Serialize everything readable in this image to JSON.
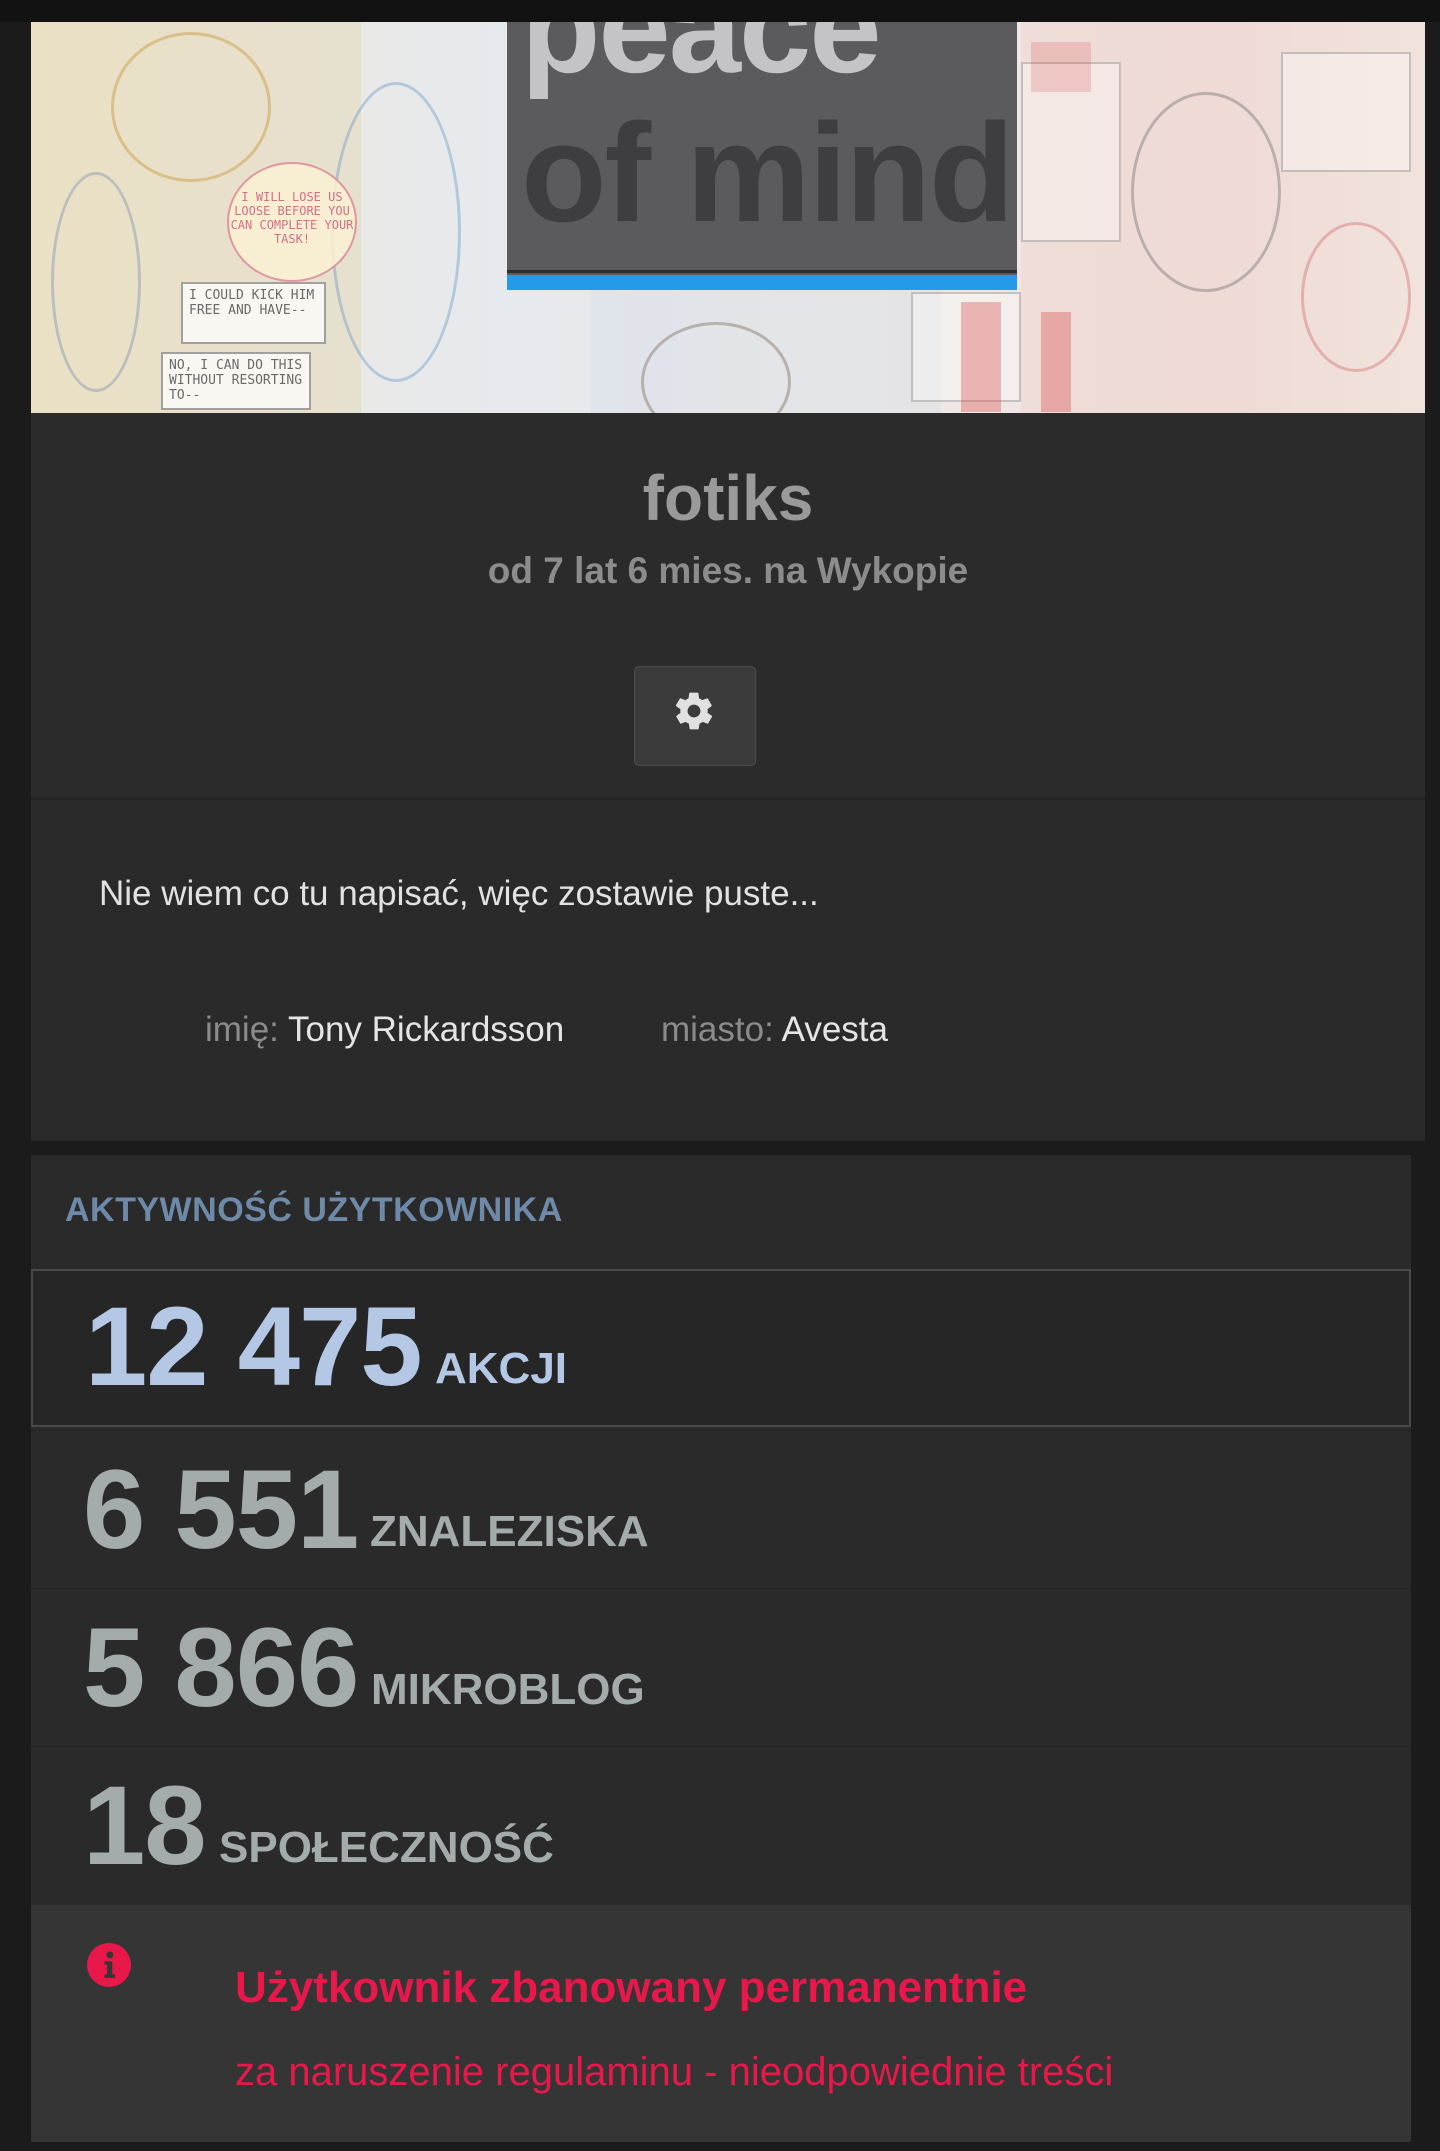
{
  "banner": {
    "line1": "peace",
    "line2": "of mind",
    "comic_text_1": "I COULD KICK HIM FREE AND HAVE--",
    "comic_text_2": "NO, I CAN DO THIS WITHOUT RESORTING TO--",
    "comic_bubble": "I WILL LOSE US LOOSE BEFORE YOU CAN COMPLETE YOUR TASK!"
  },
  "profile": {
    "username": "fotiks",
    "member_since": "od 7 lat 6 mies. na Wykopie",
    "settings_icon": "gear-icon"
  },
  "about": {
    "description": "Nie wiem co tu napisać, więc zostawie puste...",
    "name_label": "imię:",
    "name_value": "Tony Rickardsson",
    "city_label": "miasto:",
    "city_value": "Avesta"
  },
  "activity": {
    "title": "AKTYWNOŚĆ UŻYTKOWNIKA",
    "stats": [
      {
        "value": "12 475",
        "label": "AKCJI"
      },
      {
        "value": "6 551",
        "label": "ZNALEZISKA"
      },
      {
        "value": "5 866",
        "label": "MIKROBLOG"
      },
      {
        "value": "18",
        "label": "SPOŁECZNOŚĆ"
      }
    ]
  },
  "ban": {
    "icon": "info-icon",
    "title": "Użytkownik zbanowany permanentnie",
    "reason": "za naruszenie regulaminu - nieodpowiednie treści"
  },
  "colors": {
    "accent_blue": "#239be8",
    "stat_primary": "#b4c8e6",
    "stat_secondary": "#a3acab",
    "ban_red": "#e8184a"
  }
}
